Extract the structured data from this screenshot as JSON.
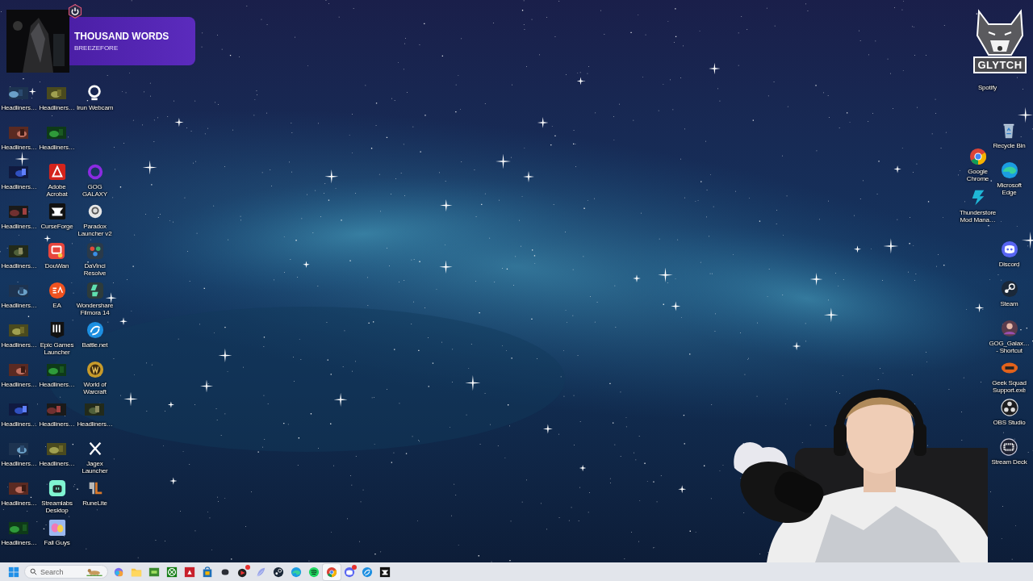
{
  "now_playing": {
    "title": "THOUSAND WORDS",
    "artist": "BREEZEFORE"
  },
  "overlay_logo": {
    "text": "GLYTCH"
  },
  "desktop_left": {
    "rows": [
      [
        {
          "label": "Headliners…",
          "kind": "thumbnail"
        },
        {
          "label": "Headliners…",
          "kind": "thumbnail"
        },
        {
          "label": "Irun Webcam",
          "kind": "app"
        }
      ],
      [
        {
          "label": "Headliners…",
          "kind": "thumbnail"
        },
        {
          "label": "Headliners…",
          "kind": "thumbnail"
        }
      ],
      [
        {
          "label": "Headliners…",
          "kind": "thumbnail"
        },
        {
          "label": "Adobe Acrobat",
          "kind": "app"
        },
        {
          "label": "GOG GALAXY",
          "kind": "app"
        }
      ],
      [
        {
          "label": "Headliners…",
          "kind": "thumbnail"
        },
        {
          "label": "CurseForge",
          "kind": "app"
        },
        {
          "label": "Paradox Launcher v2",
          "kind": "app"
        }
      ],
      [
        {
          "label": "Headliners…",
          "kind": "thumbnail"
        },
        {
          "label": "DouWan",
          "kind": "app"
        },
        {
          "label": "DaVinci Resolve",
          "kind": "app"
        }
      ],
      [
        {
          "label": "Headliners…",
          "kind": "thumbnail"
        },
        {
          "label": "EA",
          "kind": "app"
        },
        {
          "label": "Wondershare Filmora 14",
          "kind": "app"
        }
      ],
      [
        {
          "label": "Headliners…",
          "kind": "thumbnail"
        },
        {
          "label": "Epic Games Launcher",
          "kind": "app"
        },
        {
          "label": "Battle.net",
          "kind": "app"
        }
      ],
      [
        {
          "label": "Headliners…",
          "kind": "thumbnail"
        },
        {
          "label": "Headliners…",
          "kind": "thumbnail"
        },
        {
          "label": "World of Warcraft",
          "kind": "app"
        }
      ],
      [
        {
          "label": "Headliners…",
          "kind": "thumbnail"
        },
        {
          "label": "Headliners…",
          "kind": "thumbnail"
        },
        {
          "label": "Headliners…",
          "kind": "thumbnail"
        }
      ],
      [
        {
          "label": "Headliners…",
          "kind": "thumbnail"
        },
        {
          "label": "Headliners…",
          "kind": "thumbnail"
        },
        {
          "label": "Jagex Launcher",
          "kind": "app"
        }
      ],
      [
        {
          "label": "Headliners…",
          "kind": "thumbnail"
        },
        {
          "label": "Streamlabs Desktop",
          "kind": "app"
        },
        {
          "label": "RuneLite",
          "kind": "app"
        }
      ],
      [
        {
          "label": "Headliners…",
          "kind": "thumbnail"
        },
        {
          "label": "Fall Guys",
          "kind": "app"
        }
      ]
    ]
  },
  "desktop_right": {
    "columns": [
      [
        {
          "label": "Spotify",
          "kind": "covered"
        },
        {
          "label": "Google Chrome",
          "kind": "app"
        },
        {
          "label": "Thunderstore Mod Mana…",
          "kind": "app"
        }
      ],
      [
        {
          "label": "Recycle Bin",
          "kind": "app"
        },
        {
          "label": "Microsoft Edge",
          "kind": "app"
        },
        {
          "label": "Discord",
          "kind": "app"
        },
        {
          "label": "Steam",
          "kind": "app"
        },
        {
          "label": "GOG_Galax… - Shortcut",
          "kind": "app"
        },
        {
          "label": "Geek Squad Support.exe",
          "kind": "app"
        },
        {
          "label": "OBS Studio",
          "kind": "app"
        },
        {
          "label": "Stream Deck",
          "kind": "app"
        }
      ]
    ]
  },
  "taskbar": {
    "search": {
      "placeholder": "Search"
    },
    "apps": [
      {
        "selected": false,
        "notification": false
      },
      {
        "selected": false,
        "notification": false
      },
      {
        "selected": false,
        "notification": false
      },
      {
        "selected": false,
        "notification": false
      },
      {
        "selected": false,
        "notification": false
      },
      {
        "selected": false,
        "notification": false
      },
      {
        "selected": false,
        "notification": false
      },
      {
        "selected": false,
        "notification": true
      },
      {
        "selected": false,
        "notification": false
      },
      {
        "selected": false,
        "notification": false
      },
      {
        "selected": false,
        "notification": false
      },
      {
        "selected": false,
        "notification": false
      },
      {
        "selected": true,
        "notification": false
      },
      {
        "selected": false,
        "notification": true
      },
      {
        "selected": false,
        "notification": false
      },
      {
        "selected": false,
        "notification": false
      }
    ]
  }
}
